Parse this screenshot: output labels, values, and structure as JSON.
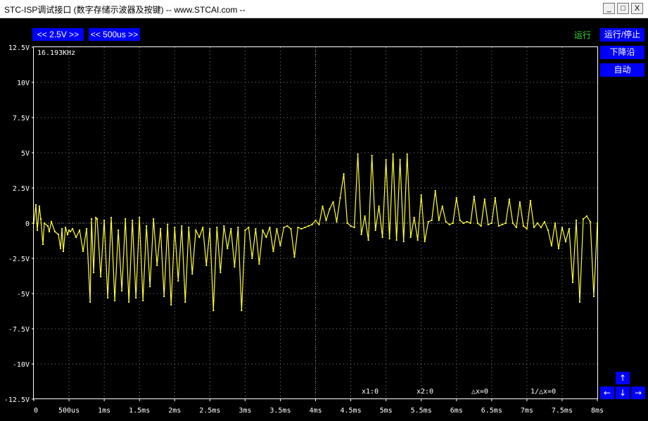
{
  "window": {
    "title": "STC-ISP调试接口 (数字存储示波器及按键) -- www.STCAI.com --",
    "minimize": "_",
    "maximize": "□",
    "close": "X"
  },
  "toolbar": {
    "volt_div": "<< 2.5V >>",
    "time_div": "<< 500us >>"
  },
  "status": {
    "run_state": "运行"
  },
  "side_buttons": {
    "run_stop": "运行/停止",
    "trigger_edge": "下降沿",
    "auto": "自动"
  },
  "measure": {
    "frequency": "16.193KHz",
    "x1": "x1:0",
    "x2": "x2:0",
    "dx": "△x=0",
    "inv_dx": "1/△x=0"
  },
  "arrows": {
    "up": "↑",
    "left": "←",
    "down": "↓",
    "right": "→"
  },
  "colors": {
    "trace": "#ffff33",
    "button": "#0000ff",
    "grid": "#808080",
    "status": "#33dd33"
  },
  "chart_data": {
    "type": "line",
    "xlabel": "",
    "ylabel": "",
    "x_ticks": [
      "0",
      "500us",
      "1ms",
      "1.5ms",
      "2ms",
      "2.5ms",
      "3ms",
      "3.5ms",
      "4ms",
      "4.5ms",
      "5ms",
      "5.5ms",
      "6ms",
      "6.5ms",
      "7ms",
      "7.5ms",
      "8ms"
    ],
    "y_ticks": [
      "12.5V",
      "10V",
      "7.5V",
      "5V",
      "2.5V",
      "0",
      "-2.5V",
      "-5V",
      "-7.5V",
      "-10V",
      "-12.5V"
    ],
    "xlim_ms": [
      0,
      8
    ],
    "ylim_V": [
      -12.5,
      12.5
    ],
    "grid": true,
    "series": [
      {
        "x_ms": [
          0,
          0.03,
          0.05,
          0.08,
          0.1,
          0.13,
          0.15,
          0.2,
          0.22,
          0.25,
          0.3,
          0.35,
          0.38,
          0.4,
          0.42,
          0.45,
          0.48,
          0.5,
          0.52,
          0.55,
          0.6,
          0.65,
          0.7,
          0.75,
          0.8,
          0.82,
          0.85,
          0.88,
          0.9,
          0.95,
          1.0,
          1.05,
          1.1,
          1.15,
          1.2,
          1.25,
          1.3,
          1.35,
          1.4,
          1.45,
          1.5,
          1.55,
          1.6,
          1.65,
          1.7,
          1.75,
          1.8,
          1.85,
          1.9,
          1.95,
          2.0,
          2.05,
          2.1,
          2.15,
          2.2,
          2.25,
          2.3,
          2.35,
          2.4,
          2.45,
          2.5,
          2.55,
          2.6,
          2.65,
          2.7,
          2.75,
          2.8,
          2.85,
          2.9,
          2.95,
          3.0,
          3.05,
          3.1,
          3.15,
          3.2,
          3.25,
          3.3,
          3.35,
          3.4,
          3.45,
          3.5,
          3.55,
          3.6,
          3.65,
          3.7,
          3.75,
          3.8,
          3.85,
          3.9,
          3.95,
          4.0,
          4.05,
          4.1,
          4.15,
          4.2,
          4.25,
          4.3,
          4.35,
          4.4,
          4.45,
          4.5,
          4.55,
          4.6,
          4.65,
          4.7,
          4.75,
          4.8,
          4.85,
          4.9,
          4.95,
          5.0,
          5.05,
          5.1,
          5.15,
          5.2,
          5.25,
          5.3,
          5.35,
          5.4,
          5.45,
          5.5,
          5.55,
          5.6,
          5.65,
          5.7,
          5.75,
          5.8,
          5.85,
          5.9,
          5.95,
          6.0,
          6.05,
          6.1,
          6.15,
          6.2,
          6.25,
          6.3,
          6.35,
          6.4,
          6.45,
          6.5,
          6.55,
          6.6,
          6.65,
          6.7,
          6.75,
          6.8,
          6.85,
          6.9,
          6.95,
          7.0,
          7.05,
          7.1,
          7.15,
          7.2,
          7.25,
          7.3,
          7.35,
          7.4,
          7.45,
          7.5,
          7.55,
          7.6,
          7.65,
          7.7,
          7.75,
          7.8,
          7.85,
          7.9,
          7.95,
          8.0
        ],
        "y_V": [
          0,
          1.3,
          -0.5,
          1.2,
          0.3,
          -1.5,
          0,
          -0.2,
          -0.6,
          0.1,
          -0.6,
          -0.8,
          -1.8,
          -0.4,
          -2.0,
          -0.3,
          -0.8,
          -0.5,
          -0.6,
          -0.4,
          -1.0,
          -0.5,
          -2.0,
          -0.4,
          -5.6,
          0.3,
          -3.5,
          0.4,
          0.3,
          -3.8,
          0.2,
          -5.3,
          0.4,
          -5.5,
          -0.5,
          -4.8,
          0.3,
          -5.6,
          0.2,
          -5.3,
          0.4,
          -5.5,
          -0.2,
          -4.5,
          0.3,
          -3.0,
          -0.4,
          -5.2,
          -0.1,
          -5.8,
          -0.3,
          -4.1,
          -0.2,
          -5.6,
          -0.3,
          -3.6,
          -0.5,
          -1.0,
          -0.3,
          -3.0,
          -0.4,
          -6.2,
          -0.3,
          -3.5,
          -0.2,
          -1.8,
          -0.4,
          -3.1,
          -0.3,
          -6.2,
          -0.5,
          -0.3,
          -2.5,
          -0.4,
          -2.9,
          -0.5,
          -1.0,
          -0.3,
          -2.0,
          -0.4,
          -1.6,
          -0.3,
          -0.2,
          -0.4,
          -2.4,
          -0.3,
          -0.4,
          -0.3,
          -0.2,
          -0.1,
          0.2,
          -0.1,
          1.2,
          0.2,
          1.0,
          1.5,
          0.1,
          1.8,
          3.5,
          0.0,
          -0.2,
          -0.3,
          4.9,
          -0.8,
          0.5,
          -1.2,
          4.8,
          -0.5,
          1.2,
          -1.0,
          4.5,
          -1.1,
          4.9,
          -1.2,
          4.5,
          -1.3,
          4.9,
          -1.0,
          0.4,
          -1.2,
          2.0,
          -1.3,
          0.1,
          0.2,
          2.3,
          0.2,
          1.2,
          0.1,
          -0.1,
          0.0,
          1.8,
          0.2,
          0.0,
          0.1,
          0.0,
          1.9,
          0.0,
          -0.2,
          1.7,
          -0.1,
          0.0,
          1.8,
          -0.2,
          -0.1,
          0.0,
          1.7,
          0.0,
          -0.3,
          1.5,
          -0.2,
          -0.4,
          1.6,
          -0.3,
          0.0,
          -0.3,
          0.1,
          -0.5,
          -1.6,
          0.0,
          -1.8,
          -0.3,
          -1.3,
          -0.4,
          -4.2,
          0.2,
          -5.6,
          0.3,
          0.5,
          0.1,
          -5.2,
          0.0
        ]
      }
    ]
  }
}
